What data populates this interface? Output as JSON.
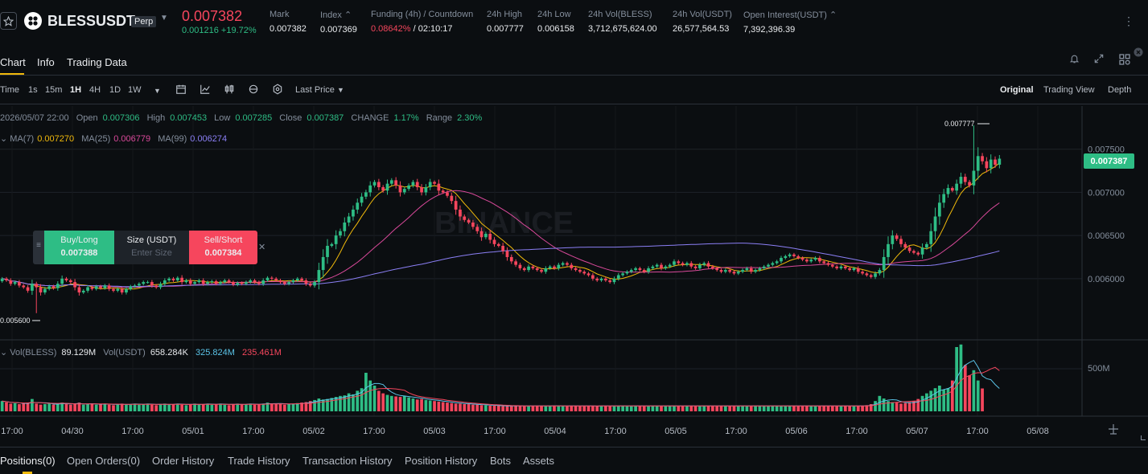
{
  "header": {
    "symbol": "BLESSUSDT",
    "contract_type": "Perp",
    "last_price": "0.007382",
    "change": "0.001216 +19.72%",
    "stats": [
      {
        "label": "Mark",
        "value": "0.007382"
      },
      {
        "label": "Index",
        "value": "0.007369"
      },
      {
        "label": "Funding (4h) / Countdown",
        "value_funding": "0.08642%",
        "value_countdown": "/ 02:10:17"
      },
      {
        "label": "24h High",
        "value": "0.007777"
      },
      {
        "label": "24h Low",
        "value": "0.006158"
      },
      {
        "label": "24h Vol(BLESS)",
        "value": "3,712,675,624.00"
      },
      {
        "label": "24h Vol(USDT)",
        "value": "26,577,564.53"
      },
      {
        "label": "Open Interest(USDT)",
        "value": "7,392,396.39"
      }
    ]
  },
  "tabs": [
    "Chart",
    "Info",
    "Trading Data"
  ],
  "toolbar": {
    "intervals": [
      "Time",
      "1s",
      "15m",
      "1H",
      "4H",
      "1D",
      "1W"
    ],
    "active_interval": "1H",
    "price_type": "Last Price",
    "views": [
      "Original",
      "Trading View",
      "Depth"
    ],
    "active_view": "Original"
  },
  "ohlc": {
    "date": "2026/05/07 22:00",
    "open_label": "Open",
    "open": "0.007306",
    "high_label": "High",
    "high": "0.007453",
    "low_label": "Low",
    "low": "0.007285",
    "close_label": "Close",
    "close": "0.007387",
    "change_label": "CHANGE",
    "change": "1.17%",
    "range_label": "Range",
    "range": "2.30%"
  },
  "ma": {
    "ma7_label": "MA(7)",
    "ma7": "0.007270",
    "ma25_label": "MA(25)",
    "ma25": "0.006779",
    "ma99_label": "MA(99)",
    "ma99": "0.006274"
  },
  "volume": {
    "label": "Vol(BLESS)",
    "bless": "89.129M",
    "usdt_label": "Vol(USDT)",
    "usdt": "658.284K",
    "ma1": "325.824M",
    "ma2": "235.461M",
    "axis_label": "500M"
  },
  "order_box": {
    "buy_label": "Buy/Long",
    "buy_price": "0.007388",
    "size_label": "Size (USDT)",
    "size_placeholder": "Enter Size",
    "sell_label": "Sell/Short",
    "sell_price": "0.007384"
  },
  "watermark": "BINANCE",
  "chart_data": {
    "type": "candlestick",
    "y_axis_ticks": [
      "0.007500",
      "0.007000",
      "0.006500",
      "0.006000"
    ],
    "x_axis_ticks": [
      "17:00",
      "04/30",
      "17:00",
      "05/01",
      "17:00",
      "05/02",
      "17:00",
      "05/03",
      "17:00",
      "05/04",
      "17:00",
      "05/05",
      "17:00",
      "05/06",
      "17:00",
      "05/07",
      "17:00",
      "05/08"
    ],
    "high_marker": "0.007777",
    "low_marker": "0.005600",
    "current_price": "0.007387",
    "ylim": [
      0.0053,
      0.008
    ],
    "close_series": [
      0.006,
      0.00598,
      0.00594,
      0.00596,
      0.00592,
      0.0059,
      0.00586,
      0.00594,
      0.0059,
      0.00584,
      0.00588,
      0.00591,
      0.00589,
      0.00594,
      0.006,
      0.00598,
      0.00596,
      0.0059,
      0.00584,
      0.00586,
      0.0059,
      0.00588,
      0.00591,
      0.00589,
      0.00592,
      0.00588,
      0.00586,
      0.00588,
      0.00584,
      0.00588,
      0.00591,
      0.00592,
      0.00594,
      0.00596,
      0.00596,
      0.00592,
      0.0059,
      0.00594,
      0.00598,
      0.006,
      0.00598,
      0.00601,
      0.00596,
      0.00598,
      0.00594,
      0.00596,
      0.00598,
      0.00594,
      0.00596,
      0.00597,
      0.00594,
      0.00596,
      0.00598,
      0.00596,
      0.00593,
      0.00595,
      0.00594,
      0.00596,
      0.00598,
      0.00596,
      0.00594,
      0.00598,
      0.00601,
      0.006,
      0.00598,
      0.00596,
      0.00594,
      0.00596,
      0.00598,
      0.006,
      0.00598,
      0.00594,
      0.00592,
      0.00596,
      0.0061,
      0.00625,
      0.00638,
      0.0064,
      0.0065,
      0.00655,
      0.00665,
      0.00672,
      0.0068,
      0.00688,
      0.00695,
      0.007,
      0.00708,
      0.00712,
      0.00706,
      0.00702,
      0.0071,
      0.00714,
      0.00708,
      0.007,
      0.00704,
      0.00708,
      0.00712,
      0.00706,
      0.007,
      0.00706,
      0.00712,
      0.0071,
      0.00702,
      0.007,
      0.00696,
      0.0069,
      0.0068,
      0.00672,
      0.00668,
      0.00665,
      0.0066,
      0.00655,
      0.00648,
      0.00652,
      0.00645,
      0.0064,
      0.00638,
      0.00632,
      0.00625,
      0.0062,
      0.00616,
      0.00612,
      0.0061,
      0.00614,
      0.00612,
      0.0061,
      0.00608,
      0.00612,
      0.00614,
      0.00612,
      0.00616,
      0.00618,
      0.00616,
      0.00612,
      0.0061,
      0.00608,
      0.00606,
      0.00604,
      0.006,
      0.00598,
      0.006,
      0.00598,
      0.00596,
      0.006,
      0.00604,
      0.00606,
      0.00608,
      0.0061,
      0.00612,
      0.0061,
      0.00608,
      0.00612,
      0.00614,
      0.00616,
      0.00612,
      0.00614,
      0.00616,
      0.0062,
      0.00618,
      0.00616,
      0.00618,
      0.00614,
      0.00612,
      0.00616,
      0.00618,
      0.00614,
      0.00612,
      0.0061,
      0.00608,
      0.0061,
      0.00608,
      0.00606,
      0.00608,
      0.0061,
      0.00612,
      0.00608,
      0.0061,
      0.00612,
      0.00614,
      0.00616,
      0.00618,
      0.0062,
      0.00624,
      0.00626,
      0.00628,
      0.00626,
      0.00624,
      0.00622,
      0.0062,
      0.00622,
      0.00624,
      0.0062,
      0.00618,
      0.00616,
      0.00614,
      0.00612,
      0.00614,
      0.00612,
      0.0061,
      0.00612,
      0.00608,
      0.00606,
      0.00604,
      0.00602,
      0.00606,
      0.0061,
      0.00625,
      0.0064,
      0.0065,
      0.00646,
      0.0064,
      0.00636,
      0.00632,
      0.0063,
      0.00628,
      0.00636,
      0.0064,
      0.00655,
      0.00672,
      0.00688,
      0.00698,
      0.00705,
      0.00702,
      0.0071,
      0.00718,
      0.00712,
      0.00708,
      0.00725,
      0.00742,
      0.00736,
      0.00728,
      0.00738,
      0.00732,
      0.00739
    ],
    "volume_series": [
      40,
      35,
      30,
      32,
      28,
      30,
      34,
      48,
      30,
      26,
      28,
      30,
      26,
      30,
      34,
      28,
      26,
      30,
      34,
      26,
      28,
      30,
      26,
      28,
      30,
      26,
      24,
      28,
      30,
      26,
      28,
      30,
      26,
      28,
      30,
      26,
      24,
      28,
      30,
      26,
      28,
      30,
      26,
      24,
      28,
      30,
      26,
      28,
      30,
      26,
      28,
      30,
      26,
      24,
      28,
      30,
      26,
      28,
      30,
      26,
      28,
      30,
      34,
      30,
      28,
      30,
      26,
      28,
      30,
      32,
      34,
      36,
      40,
      44,
      50,
      46,
      48,
      52,
      56,
      60,
      62,
      70,
      66,
      80,
      90,
      150,
      120,
      100,
      80,
      70,
      64,
      60,
      58,
      56,
      60,
      54,
      50,
      46,
      48,
      44,
      42,
      40,
      38,
      36,
      34,
      32,
      30,
      30,
      28,
      28,
      26,
      26,
      24,
      24,
      22,
      22,
      22,
      20,
      20,
      20,
      22,
      22,
      20,
      20,
      20,
      22,
      22,
      20,
      22,
      22,
      22,
      20,
      20,
      22,
      22,
      20,
      20,
      22,
      20,
      20,
      22,
      22,
      20,
      20,
      22,
      22,
      20,
      20,
      22,
      22,
      20,
      20,
      22,
      22,
      20,
      20,
      22,
      22,
      20,
      20,
      22,
      22,
      20,
      20,
      22,
      22,
      20,
      20,
      22,
      22,
      20,
      20,
      22,
      22,
      20,
      20,
      22,
      22,
      20,
      20,
      22,
      22,
      20,
      20,
      22,
      22,
      20,
      20,
      22,
      22,
      20,
      20,
      22,
      22,
      20,
      20,
      22,
      22,
      20,
      20,
      22,
      22,
      24,
      28,
      40,
      60,
      50,
      40,
      36,
      34,
      30,
      32,
      36,
      40,
      48,
      60,
      70,
      80,
      90,
      100,
      84,
      90,
      120,
      250,
      260,
      180,
      140,
      160,
      120,
      89
    ]
  },
  "bottom_tabs": [
    "Positions(0)",
    "Open Orders(0)",
    "Order History",
    "Trade History",
    "Transaction History",
    "Position History",
    "Bots",
    "Assets"
  ],
  "colors": {
    "up": "#2ebd85",
    "down": "#f6465d",
    "ma7": "#f0b90b",
    "ma25": "#d9499a",
    "ma99": "#8b7ff5",
    "accent": "#f0b90b"
  }
}
